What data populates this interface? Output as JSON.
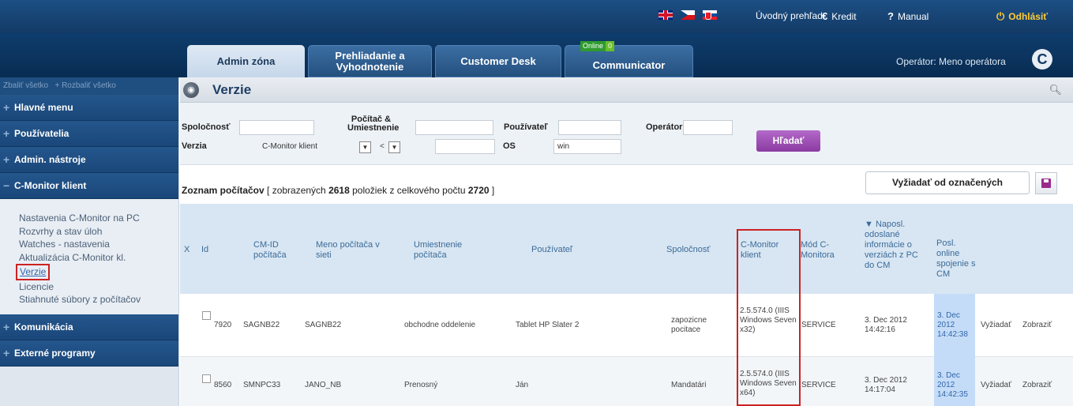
{
  "topbar": {
    "flags": [
      "uk-flag-icon",
      "cz-flag-icon",
      "sk-flag-icon"
    ],
    "overview": "Úvodný prehľad",
    "credit": "Kredit",
    "manual": "Manual",
    "logout": "Odhlásiť"
  },
  "tabs": [
    {
      "label": "Admin zóna"
    },
    {
      "label": "Prehliadanie a Vyhodnotenie"
    },
    {
      "label": "Customer Desk"
    },
    {
      "label": "Communicator"
    }
  ],
  "online_badge": {
    "label": "Online",
    "count": "0"
  },
  "operator": "Operátor: Meno operátora",
  "logo_letter": "C",
  "sidebar": {
    "collapse_all": "Zbaliť všetko",
    "expand_all": "Rozbaliť všetko",
    "groups": [
      "Hlavné menu",
      "Používatelia",
      "Admin. nástroje",
      "C-Monitor klient"
    ],
    "subitems": [
      "Nastavenia C-Monitor na PC",
      "Rozvrhy a stav úloh",
      "Watches - nastavenia",
      "Aktualizácia C-Monitor kl.",
      "Verzie",
      "Licencie",
      "Stiahnuté súbory z počítačov"
    ],
    "bottom_groups": [
      "Komunikácia",
      "Externé programy"
    ]
  },
  "page_title": "Verzie",
  "filters": {
    "company_label": "Spoločnosť",
    "computer_label": "Počítač & Umiestnenie",
    "user_label": "Používateľ",
    "operator_label": "Operátor",
    "version_label": "Verzia",
    "version_value": "C-Monitor klient",
    "compare_value": "<",
    "os_label": "OS",
    "os_value": "win",
    "search_button": "Hľadať"
  },
  "list": {
    "prefix": "Zoznam počítačov [ zobrazených ",
    "shown": "2618",
    "middle": " položiek z celkového počtu ",
    "total": "2720",
    "suffix": " ]",
    "request_button": "Vyžiadať od označených"
  },
  "columns": {
    "x": "X",
    "id": "Id",
    "cmid": "CM-ID počítača",
    "name": "Meno počítača v sieti",
    "location": "Umiestnenie počítača",
    "user": "Používateľ",
    "company": "Spoločnosť",
    "client": "C-Monitor klient",
    "mode": "Mód C-Monitora",
    "lastsent": "▼ Naposl. odoslané informácie o verziách z PC do CM",
    "lastonline": "Posl. online spojenie s CM"
  },
  "rows": [
    {
      "id": "7920",
      "cmid": "SAGNB22",
      "name": "SAGNB22",
      "location": "obchodne oddelenie",
      "user": "Tablet HP Slater 2",
      "company": "zapozicne pocitace",
      "client": "2.5.574.0 (IIIS Windows Seven x32)",
      "mode": "SERVICE",
      "lastsent": "3. Dec 2012 14:42:16",
      "lastonline": "3. Dec 2012 14:42:38",
      "request": "Vyžiadať",
      "show": "Zobraziť"
    },
    {
      "id": "8560",
      "cmid": "SMNPC33",
      "name": "JANO_NB",
      "location": "Prenosný",
      "user": "Ján",
      "company": "Mandatári",
      "client": "2.5.574.0 (IIIS Windows Seven x64)",
      "mode": "SERVICE",
      "lastsent": "3. Dec 2012 14:17:04",
      "lastonline": "3. Dec 2012 14:42:35",
      "request": "Vyžiadať",
      "show": "Zobraziť"
    }
  ]
}
